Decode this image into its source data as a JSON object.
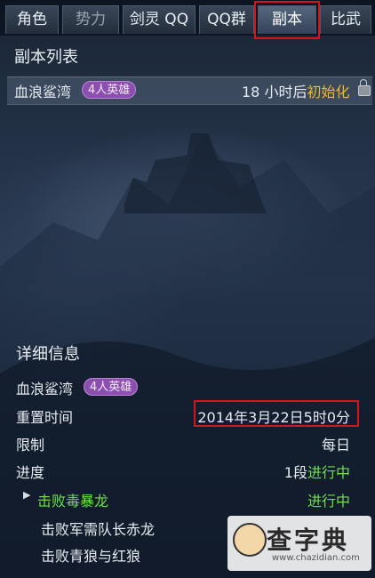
{
  "tabs": [
    {
      "label": "角色"
    },
    {
      "label": "势力"
    },
    {
      "label": "剑灵 QQ"
    },
    {
      "label": "QQ群"
    },
    {
      "label": "副本",
      "active": true
    },
    {
      "label": "比武"
    }
  ],
  "list": {
    "title": "副本列表",
    "items": [
      {
        "name": "血浪鲨湾",
        "badge": "4人英雄",
        "countdown_prefix": "18 小时后",
        "countdown_suffix": "初始化",
        "locked": true
      }
    ]
  },
  "details": {
    "title": "详细信息",
    "name": "血浪鲨湾",
    "badge": "4人英雄",
    "rows": [
      {
        "label": "重置时间",
        "value": "2014年3月22日5时0分"
      },
      {
        "label": "限制",
        "value": "每日"
      },
      {
        "label": "进度"
      }
    ],
    "progress_stage": "1段",
    "progress_status": "进行中",
    "objectives": [
      {
        "name": "击败毒暴龙",
        "status": "进行中"
      },
      {
        "name": "击败军需队长赤龙"
      },
      {
        "name": "击败青狼与红狼"
      }
    ]
  },
  "watermark": {
    "text": "查字典",
    "url": "www.chazidian.com"
  },
  "colors": {
    "highlight": "#d2161b",
    "accent_yellow": "#f0b82b",
    "accent_green": "#6de04a",
    "badge_purple": "#8c4fb0"
  }
}
